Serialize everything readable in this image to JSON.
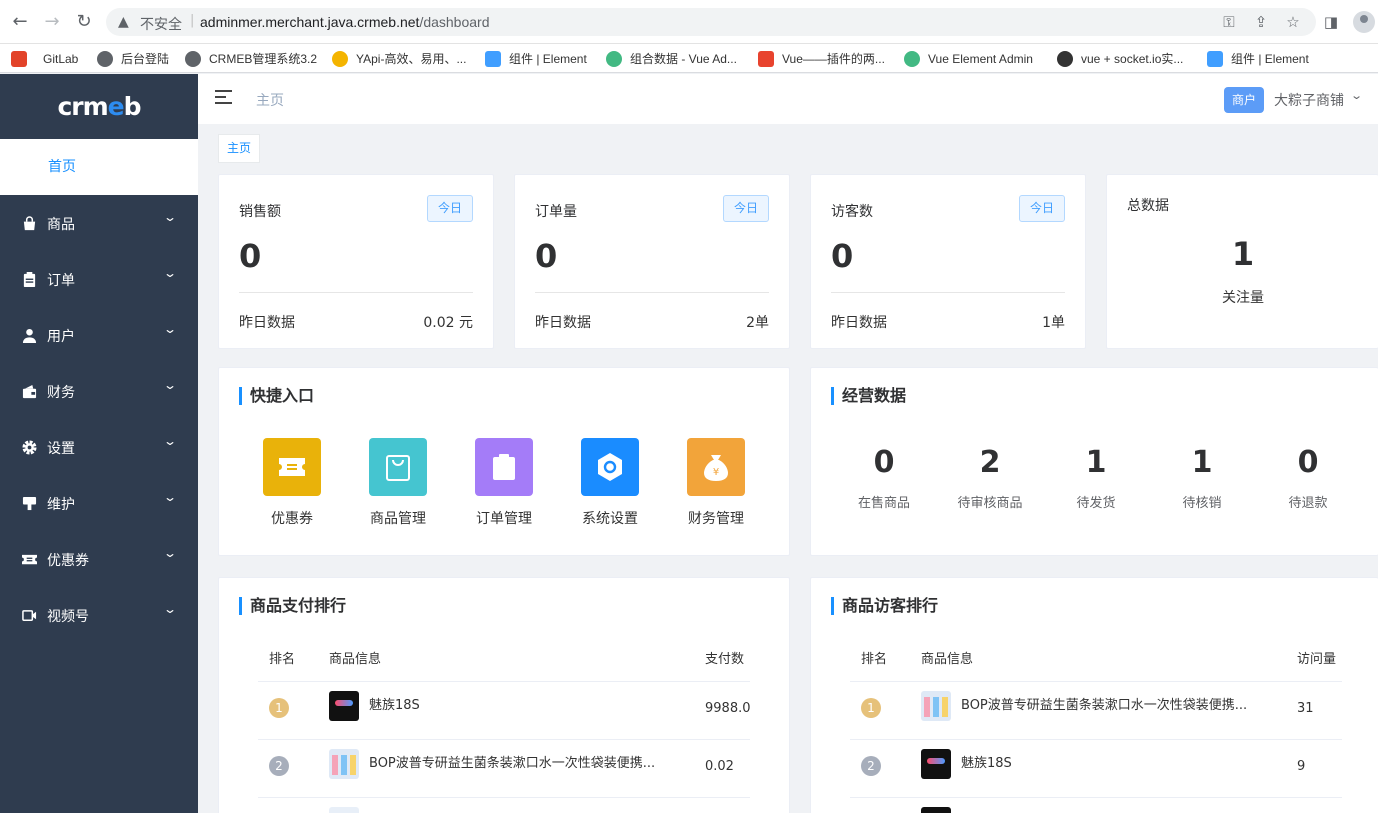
{
  "browser": {
    "insecure_label": "不安全",
    "url_host": "adminmer.merchant.java.crmeb.net",
    "url_path": "/dashboard"
  },
  "bookmarks": [
    {
      "label": "GitLab",
      "icon_color": "#e24329"
    },
    {
      "label": "后台登陆",
      "icon_color": "#5f6368"
    },
    {
      "label": "CRMEB管理系统3.2",
      "icon_color": "#5f6368"
    },
    {
      "label": "YApi-高效、易用、...",
      "icon_color": "#f4b400"
    },
    {
      "label": "组件 | Element",
      "icon_color": "#409eff"
    },
    {
      "label": "组合数据 - Vue Ad...",
      "icon_color": "#42b983"
    },
    {
      "label": "Vue——插件的两...",
      "icon_color": "#e8432e"
    },
    {
      "label": "Vue Element Admin",
      "icon_color": "#42b983"
    },
    {
      "label": "vue + socket.io实...",
      "icon_color": "#333333"
    },
    {
      "label": "组件 | Element",
      "icon_color": "#409eff"
    }
  ],
  "sidebar": {
    "logo_text_a": "crm",
    "logo_text_b": "e",
    "logo_text_c": "b",
    "active_item": "首页",
    "items": [
      {
        "label": "商品",
        "icon": "bag-icon"
      },
      {
        "label": "订单",
        "icon": "clipboard-icon"
      },
      {
        "label": "用户",
        "icon": "user-icon"
      },
      {
        "label": "财务",
        "icon": "wallet-icon"
      },
      {
        "label": "设置",
        "icon": "gear-icon"
      },
      {
        "label": "维护",
        "icon": "stamp-icon"
      },
      {
        "label": "优惠券",
        "icon": "ticket-icon"
      },
      {
        "label": "视频号",
        "icon": "video-icon"
      }
    ]
  },
  "header": {
    "breadcrumb": "主页",
    "merchant_tag": "商户",
    "merchant_name": "大粽子商铺"
  },
  "tag_view": "主页",
  "stats": [
    {
      "title": "销售额",
      "tag": "今日",
      "value": "0",
      "foot_label": "昨日数据",
      "foot_value": "0.02 元"
    },
    {
      "title": "订单量",
      "tag": "今日",
      "value": "0",
      "foot_label": "昨日数据",
      "foot_value": "2单"
    },
    {
      "title": "访客数",
      "tag": "今日",
      "value": "0",
      "foot_label": "昨日数据",
      "foot_value": "1单"
    }
  ],
  "total": {
    "title": "总数据",
    "value": "1",
    "label": "关注量"
  },
  "quick_entry": {
    "title": "快捷入口",
    "items": [
      {
        "label": "优惠券",
        "color": "#e9b20a",
        "icon": "coupon-icon"
      },
      {
        "label": "商品管理",
        "color": "#45c5d0",
        "icon": "shopping-bag-icon"
      },
      {
        "label": "订单管理",
        "color": "#a47cf8",
        "icon": "clipboard-icon"
      },
      {
        "label": "系统设置",
        "color": "#1a8cff",
        "icon": "hexagon-gear-icon"
      },
      {
        "label": "财务管理",
        "color": "#f2a43a",
        "icon": "money-bag-icon"
      }
    ]
  },
  "business": {
    "title": "经营数据",
    "items": [
      {
        "value": "0",
        "label": "在售商品"
      },
      {
        "value": "2",
        "label": "待审核商品"
      },
      {
        "value": "1",
        "label": "待发货"
      },
      {
        "value": "1",
        "label": "待核销"
      },
      {
        "value": "0",
        "label": "待退款"
      }
    ]
  },
  "pay_rank": {
    "title": "商品支付排行",
    "headers": [
      "排名",
      "商品信息",
      "支付数"
    ],
    "rows": [
      {
        "rank": "1",
        "name": "魅族18S",
        "value": "9988.0",
        "thumb": "phone"
      },
      {
        "rank": "2",
        "name": "BOP波普专研益生菌条装漱口水一次性袋装便携...",
        "value": "0.02",
        "thumb": "mouthwash"
      }
    ]
  },
  "visit_rank": {
    "title": "商品访客排行",
    "headers": [
      "排名",
      "商品信息",
      "访问量"
    ],
    "rows": [
      {
        "rank": "1",
        "name": "BOP波普专研益生菌条装漱口水一次性袋装便携...",
        "value": "31",
        "thumb": "mouthwash"
      },
      {
        "rank": "2",
        "name": "魅族18S",
        "value": "9",
        "thumb": "phone"
      }
    ]
  },
  "colors": {
    "sidebar_bg": "#2f3c4f",
    "accent": "#1890ff",
    "rank_gold": "#e6c17a",
    "rank_silver": "#a7aebb"
  }
}
